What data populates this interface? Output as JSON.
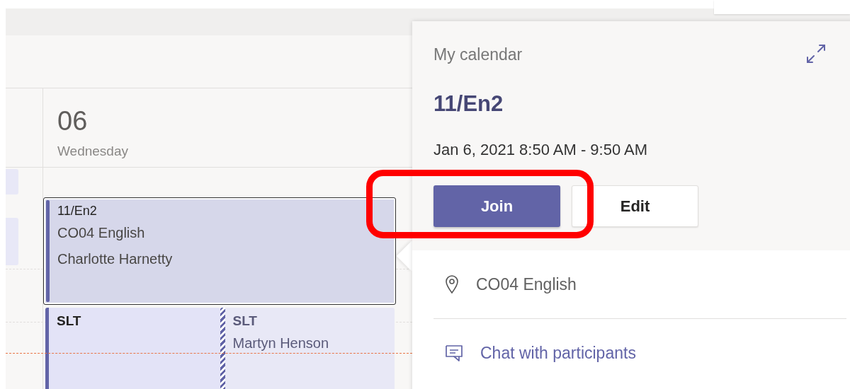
{
  "calendar": {
    "day_number": "06",
    "day_name": "Wednesday",
    "events": [
      {
        "title": "11/En2",
        "location": "CO04 English",
        "organizer": "Charlotte Harnetty",
        "selected": true,
        "kind": "busy"
      },
      {
        "title": "SLT",
        "selected": false,
        "kind": "busy"
      },
      {
        "title": "SLT",
        "organizer": "Martyn Henson",
        "selected": false,
        "kind": "tentative"
      }
    ]
  },
  "details": {
    "calendar_name": "My calendar",
    "title": "11/En2",
    "time": "Jan 6, 2021 8:50 AM - 9:50 AM",
    "buttons": [
      {
        "label": "Join",
        "kind": "primary"
      },
      {
        "label": "Edit",
        "kind": "secondary"
      }
    ],
    "location": "CO04 English",
    "chat_link": "Chat with participants"
  },
  "annotation": {
    "kind": "rounded-rectangle"
  }
}
